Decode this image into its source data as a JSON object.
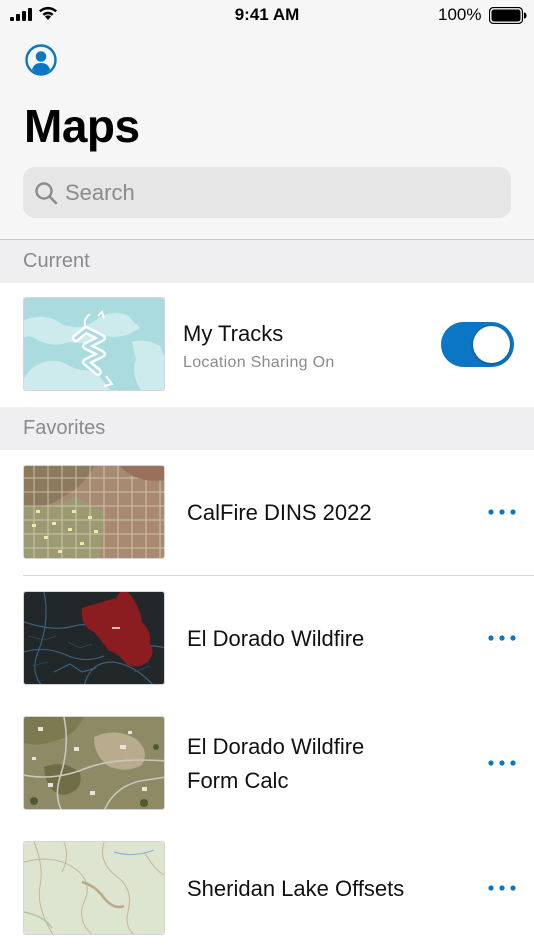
{
  "status_bar": {
    "time": "9:41 AM",
    "battery": "100%"
  },
  "header": {
    "title": "Maps"
  },
  "search": {
    "placeholder": "Search"
  },
  "sections": {
    "current": "Current",
    "favorites": "Favorites"
  },
  "current": {
    "title": "My Tracks",
    "subtitle": "Location Sharing On",
    "toggle_on": true
  },
  "favorites": [
    {
      "line1": "CalFire DINS 2022",
      "line2": ""
    },
    {
      "line1": "El Dorado Wildfire",
      "line2": ""
    },
    {
      "line1": "El Dorado Wildfire",
      "line2": "Form Calc"
    },
    {
      "line1": "Sheridan Lake Offsets",
      "line2": ""
    }
  ],
  "colors": {
    "accent": "#0b76c4",
    "section_bg": "#efeff1",
    "header_bg": "#f6f6f6"
  },
  "icons": [
    "cellular-signal-icon",
    "wifi-icon",
    "battery-icon",
    "profile-icon",
    "search-icon",
    "more-icon"
  ]
}
